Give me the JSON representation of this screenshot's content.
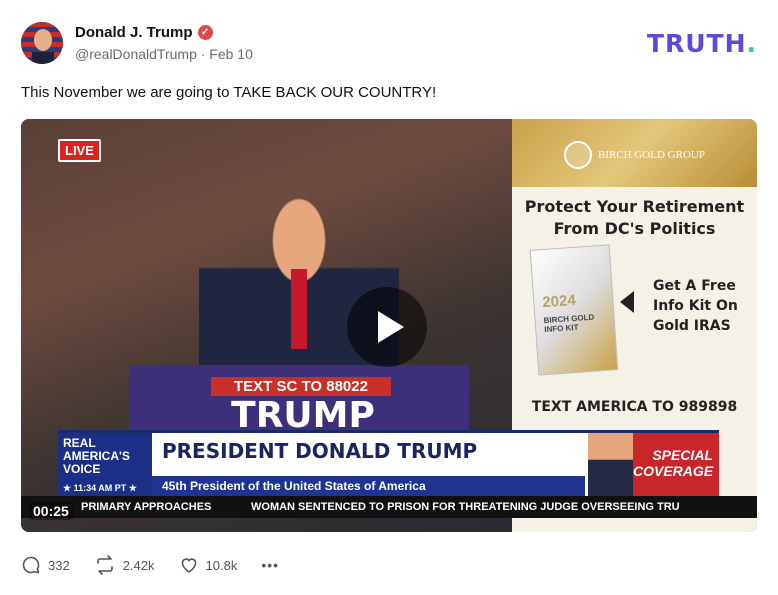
{
  "post": {
    "author_name": "Donald J. Trump",
    "handle_date": "@realDonaldTrump · Feb 10",
    "text": "This November we are going to TAKE BACK OUR COUNTRY!"
  },
  "brand": {
    "logo": "TRUTH",
    "logo_dot": "."
  },
  "video": {
    "live_badge": "LIVE",
    "podium_sign": "TEXT SC TO 88022",
    "podium_name": "TRUMP",
    "lower_third_badge": "REAL AMERICA'S VOICE",
    "lower_third_time": "★ 11:34 AM PT ★",
    "lower_third_name": "PRESIDENT DONALD TRUMP",
    "lower_third_subtitle": "45th President of the United States of America",
    "special_label": "SPECIAL COVERAGE",
    "ticker_left": "PRIMARY APPROACHES",
    "ticker_right": "WOMAN SENTENCED TO PRISON FOR THREATENING JUDGE OVERSEEING TRU",
    "timestamp": "00:25",
    "ad": {
      "brand": "BIRCH GOLD GROUP",
      "headline": "Protect Your Retirement\nFrom DC's Politics",
      "book_year": "2024",
      "book_title": "BIRCH GOLD INFO KIT",
      "offer": "Get A Free\nInfo Kit On\nGold IRAS",
      "cta": "TEXT AMERICA TO 989898"
    }
  },
  "actions": {
    "replies": "332",
    "retruths": "2.42k",
    "likes": "10.8k",
    "more": "•••"
  }
}
